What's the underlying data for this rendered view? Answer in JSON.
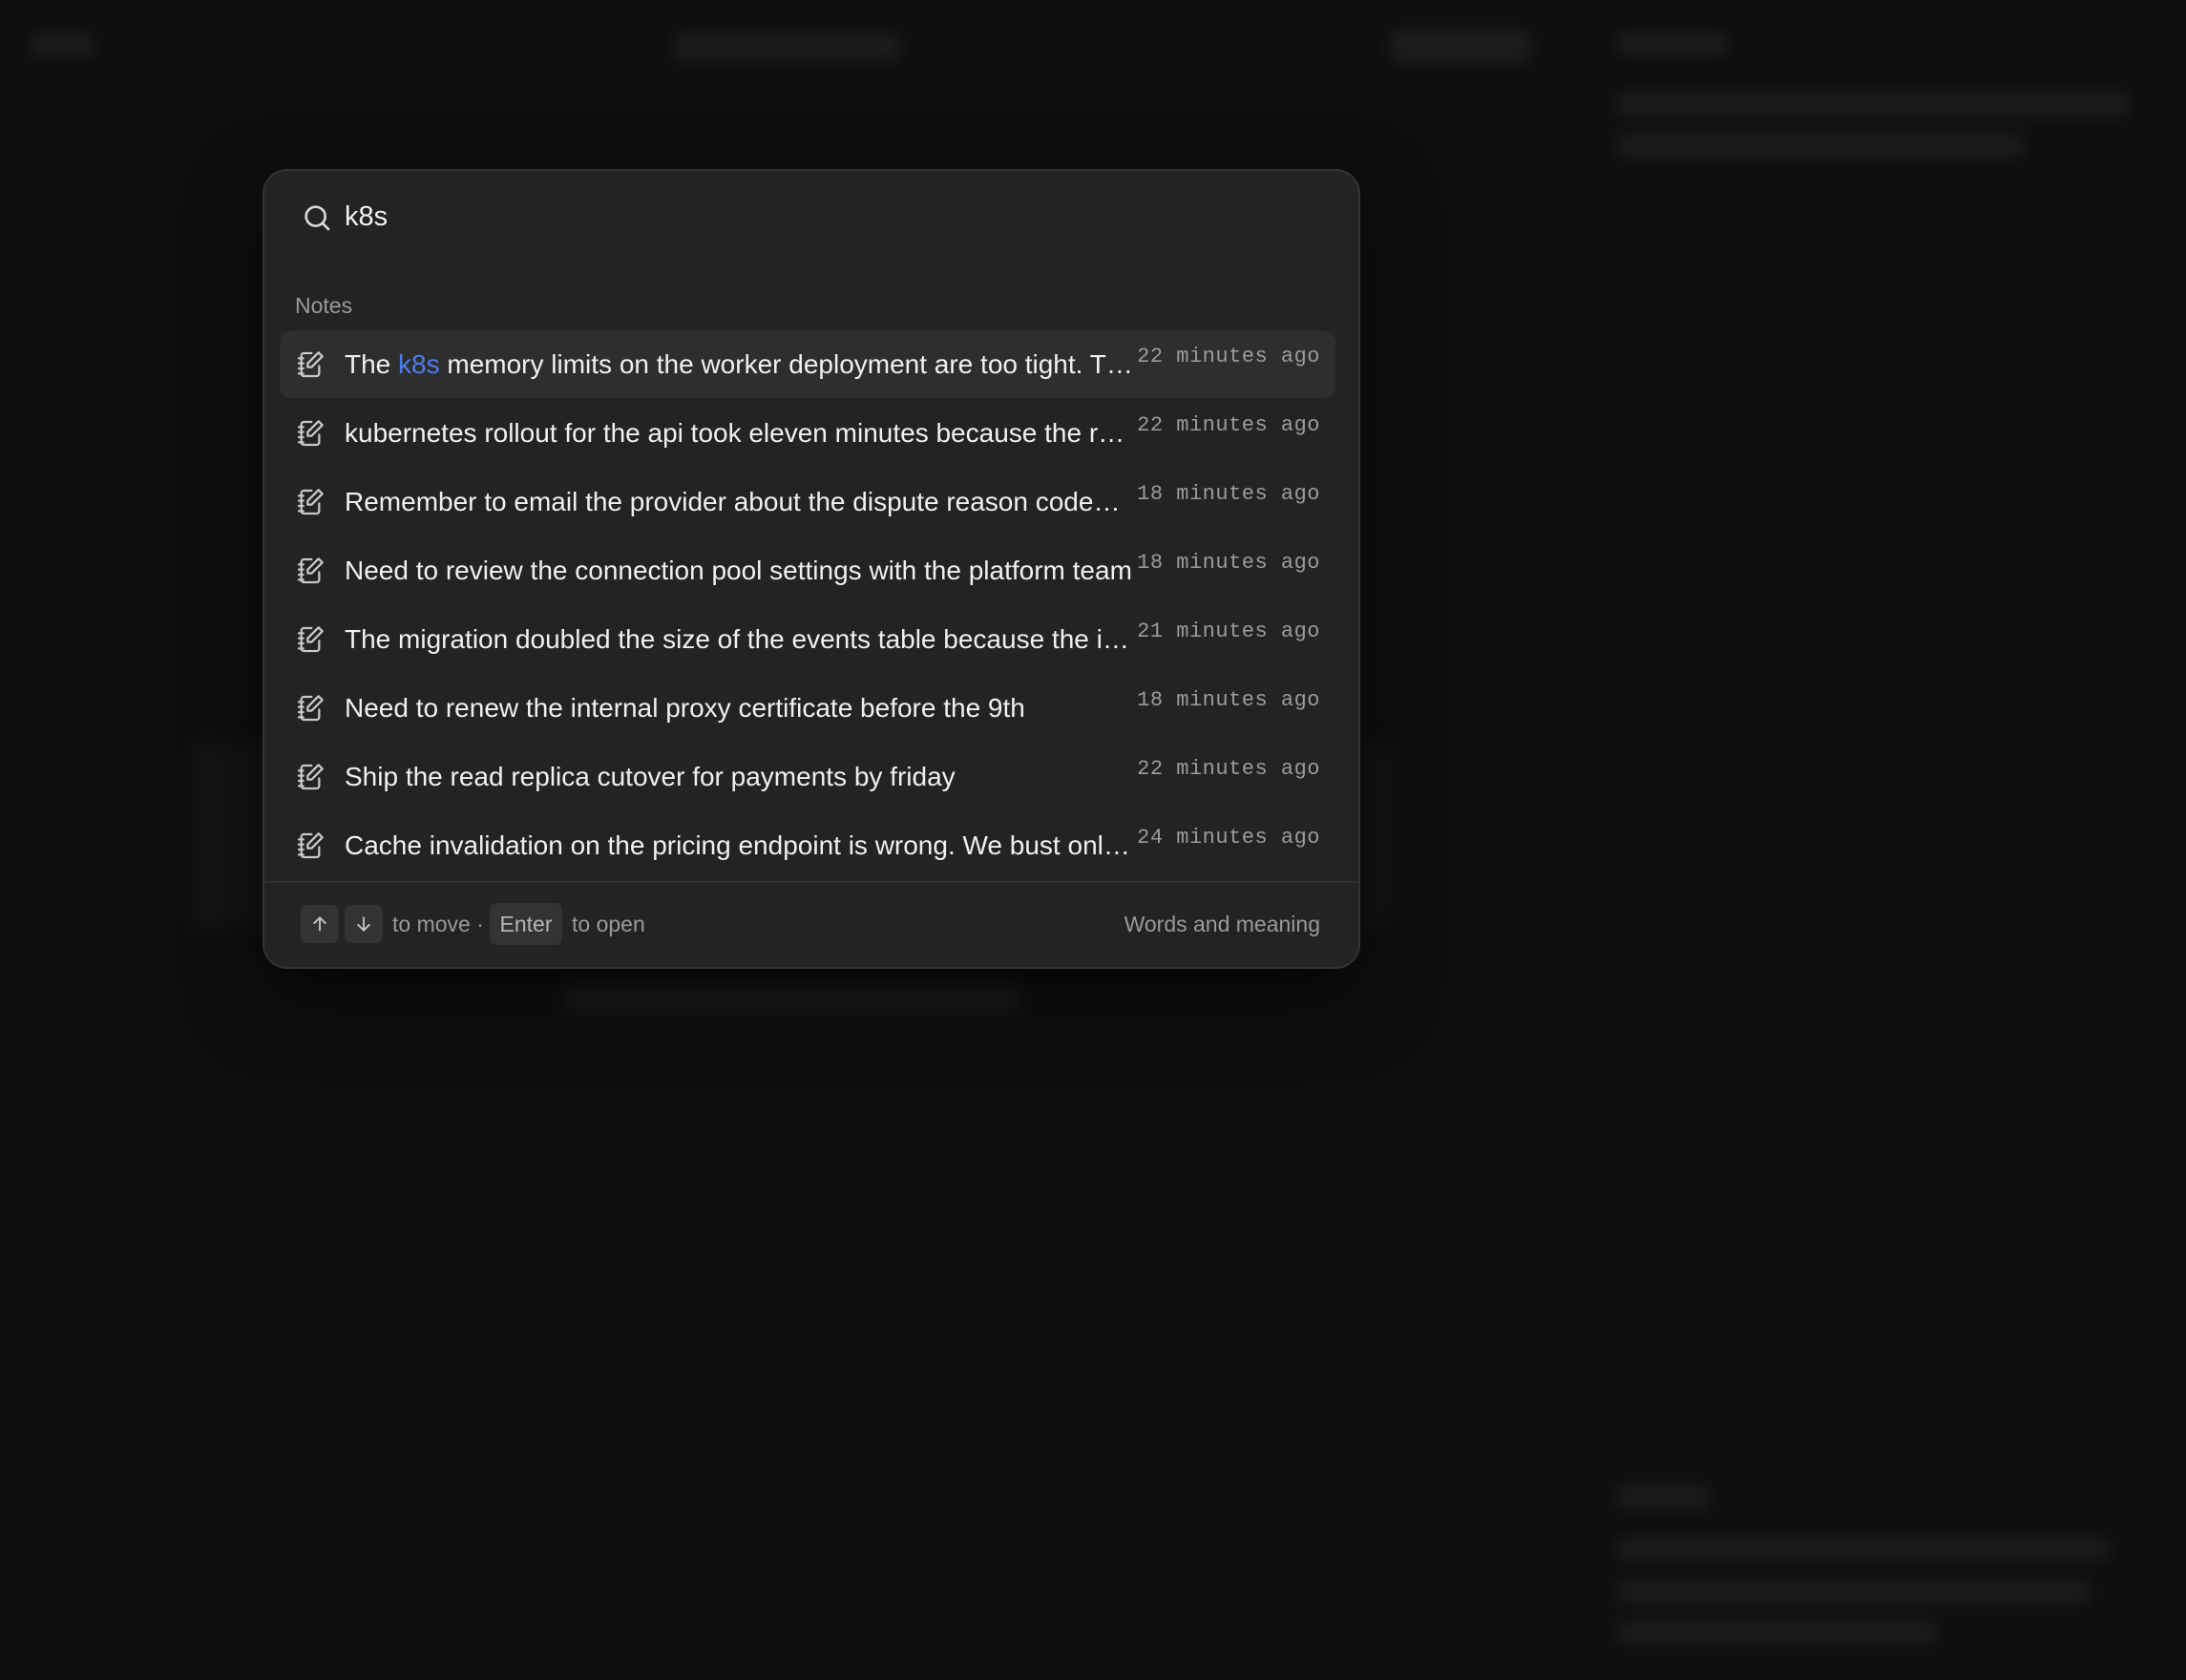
{
  "search": {
    "query": "k8s",
    "placeholder": ""
  },
  "section_label": "Notes",
  "results": [
    {
      "pre": "The ",
      "match": "k8s",
      "post": " memory limits on the worker deployment are too tight. The pods get OOMKilled",
      "time": "22 minutes ago",
      "selected": true
    },
    {
      "pre": "kubernetes rollout for the api took eleven minutes because the readiness probe",
      "match": "",
      "post": "",
      "time": "22 minutes ago"
    },
    {
      "pre": "Remember to email the provider about the dispute reason codes they changed",
      "match": "",
      "post": "",
      "time": "18 minutes ago"
    },
    {
      "pre": "Need to review the connection pool settings with the platform team",
      "match": "",
      "post": "",
      "time": "18 minutes ago"
    },
    {
      "pre": "The migration doubled the size of the events table because the index was rebuilt",
      "match": "",
      "post": "",
      "time": "21 minutes ago"
    },
    {
      "pre": "Need to renew the internal proxy certificate before the 9th",
      "match": "",
      "post": "",
      "time": "18 minutes ago"
    },
    {
      "pre": "Ship the read replica cutover for payments by friday",
      "match": "",
      "post": "",
      "time": "22 minutes ago"
    },
    {
      "pre": "Cache invalidation on the pricing endpoint is wrong. We bust only the list cache",
      "match": "",
      "post": "",
      "time": "24 minutes ago"
    }
  ],
  "footer": {
    "move_hint": "to move ·",
    "enter_key": "Enter",
    "open_hint": "to open",
    "mode": "Words and meaning"
  },
  "colors": {
    "highlight": "#4a7cf0",
    "modal_bg": "#232323",
    "page_bg": "#0e0e0e"
  },
  "icons": {
    "search": "search-icon",
    "note": "note-edit-icon",
    "up": "arrow-up-icon",
    "down": "arrow-down-icon"
  }
}
